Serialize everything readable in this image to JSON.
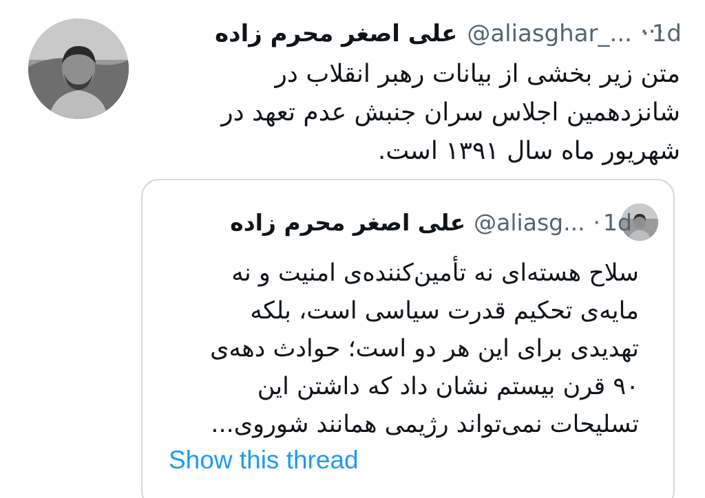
{
  "tweet": {
    "author_name": "علی اصغر محرم زاده",
    "handle": "@aliasghar_...",
    "separator": "·",
    "time": "1d",
    "more_label": "···",
    "lines": [
      "متن زیر بخشی از بیانات رهبر انقلاب در",
      "شانزدهمین اجلاس سران جنبش عدم تعهد در",
      "شهریور ماه سال ۱۳۹۱ است."
    ]
  },
  "quote": {
    "author_name": "علی اصغر محرم زاده",
    "handle": "@aliasg...",
    "separator": "·",
    "time": "1d",
    "lines": [
      "سلاح هسته‌ای نه تأمین‌کننده‌ی امنیت و نه",
      "مایه‌ی تحکیم قدرت سیاسی است، بلکه",
      "تهدیدی برای این هر دو است؛ حوادث دهه‌ی",
      "۹۰ قرن بیستم نشان داد که داشتن این",
      "تسلیحات نمی‌تواند رژیمی همانند شوروی..."
    ],
    "show_thread_label": "Show this thread"
  },
  "colors": {
    "text": "#0f1419",
    "secondary": "#536471",
    "link": "#1d9bf0",
    "border": "#cfd9de"
  },
  "icons": {
    "avatar": "profile-photo",
    "more": "more-options-icon"
  }
}
